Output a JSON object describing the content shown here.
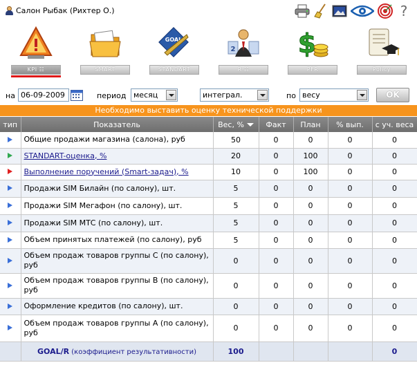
{
  "header": {
    "user_label": "Салон Рыбак  (Рихтер О.)",
    "tools": [
      "printer-icon",
      "broom-icon",
      "image-icon",
      "eye-icon",
      "target-icon",
      "help-icon"
    ],
    "help_glyph": "?"
  },
  "nav": {
    "items": [
      {
        "label": "KPI  ☷",
        "icon": "warning-kpi-icon",
        "active": true
      },
      {
        "label": "SMART",
        "icon": "folder-icon",
        "active": false
      },
      {
        "label": "STANDART",
        "icon": "goal-compass-icon",
        "active": false
      },
      {
        "label": "R  ☷",
        "icon": "rating-person-icon",
        "active": false
      },
      {
        "label": "PFR",
        "icon": "money-icon",
        "active": false
      },
      {
        "label": "Policy",
        "icon": "policy-scroll-icon",
        "active": false
      }
    ]
  },
  "filters": {
    "date_label": "на",
    "date_value": "06-09-2009",
    "period_label": "период",
    "period_value": "месяц",
    "mode_value": "интеграл.",
    "by_label": "по",
    "by_value": "весу",
    "ok_label": "OK"
  },
  "banner": "Необходимо выставить оценку технической поддержки",
  "table": {
    "headers": [
      "тип",
      "Показатель",
      "Вес, %",
      "Факт",
      "План",
      "% вып.",
      "с уч. веса"
    ],
    "rows": [
      {
        "type": "blue",
        "name": "Общие продажи магазина (салона), руб",
        "link": false,
        "weight": "50",
        "fact": "0",
        "plan": "0",
        "pct": "0",
        "weighted": "0"
      },
      {
        "type": "green",
        "name": "STANDART-оценка, %",
        "link": true,
        "weight": "20",
        "fact": "0",
        "plan": "100",
        "pct": "0",
        "weighted": "0"
      },
      {
        "type": "red",
        "name": "Выполнение поручений (Smart-задач), %",
        "link": true,
        "weight": "10",
        "fact": "0",
        "plan": "100",
        "pct": "0",
        "weighted": "0"
      },
      {
        "type": "blue",
        "name": "Продажи SIM Билайн (по салону), шт.",
        "link": false,
        "weight": "5",
        "fact": "0",
        "plan": "0",
        "pct": "0",
        "weighted": "0"
      },
      {
        "type": "blue",
        "name": "Продажи SIM Мегафон (по салону), шт.",
        "link": false,
        "weight": "5",
        "fact": "0",
        "plan": "0",
        "pct": "0",
        "weighted": "0"
      },
      {
        "type": "blue",
        "name": "Продажи SIM МТС (по салону), шт.",
        "link": false,
        "weight": "5",
        "fact": "0",
        "plan": "0",
        "pct": "0",
        "weighted": "0"
      },
      {
        "type": "blue",
        "name": "Объем принятых платежей (по салону), руб",
        "link": false,
        "weight": "5",
        "fact": "0",
        "plan": "0",
        "pct": "0",
        "weighted": "0"
      },
      {
        "type": "blue",
        "name": "Объем продаж товаров группы C (по салону), руб",
        "link": false,
        "weight": "0",
        "fact": "0",
        "plan": "0",
        "pct": "0",
        "weighted": "0"
      },
      {
        "type": "blue",
        "name": "Объем продаж товаров группы B (по салону), руб",
        "link": false,
        "weight": "0",
        "fact": "0",
        "plan": "0",
        "pct": "0",
        "weighted": "0"
      },
      {
        "type": "blue",
        "name": "Оформление кредитов (по салону), шт.",
        "link": false,
        "weight": "0",
        "fact": "0",
        "plan": "0",
        "pct": "0",
        "weighted": "0"
      },
      {
        "type": "blue",
        "name": "Объем продаж товаров группы A (по салону), руб",
        "link": false,
        "weight": "0",
        "fact": "0",
        "plan": "0",
        "pct": "0",
        "weighted": "0"
      }
    ],
    "footer": {
      "label_bold": "GOAL/R",
      "label_small": " (коэффициент результативности)",
      "weight": "100",
      "weighted": "0"
    }
  }
}
